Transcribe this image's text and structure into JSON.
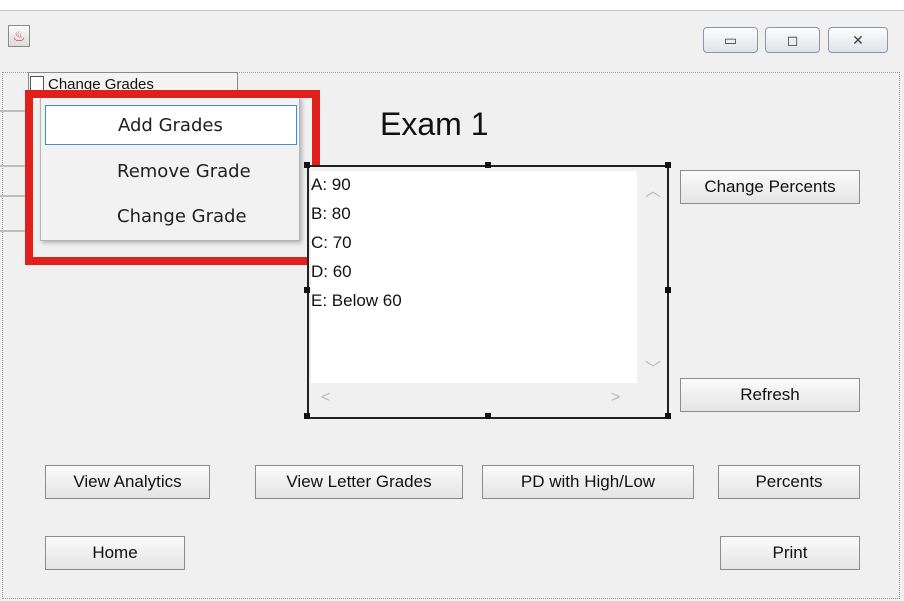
{
  "window": {
    "app_icon": "java-cup-icon",
    "controls": {
      "minimize": "minimize-icon",
      "maximize": "maximize-icon",
      "close": "close-icon"
    }
  },
  "menu": {
    "label": "Change Grades",
    "items": [
      "Add Grades",
      "Remove Grade",
      "Change Grade"
    ],
    "selected_index": 0
  },
  "main": {
    "title": "Exam 1",
    "grade_scale": [
      "A: 90",
      "B: 80",
      "C: 70",
      "D: 60",
      "E: Below 60"
    ]
  },
  "buttons": {
    "change_percents": "Change Percents",
    "refresh": "Refresh",
    "view_analytics": "View Analytics",
    "view_letter_grades": "View Letter Grades",
    "pd_high_low": "PD with High/Low",
    "percents": "Percents",
    "home": "Home",
    "print": "Print"
  },
  "colors": {
    "annotation_highlight": "#e0201c",
    "selection_border": "#3c8ddb"
  }
}
